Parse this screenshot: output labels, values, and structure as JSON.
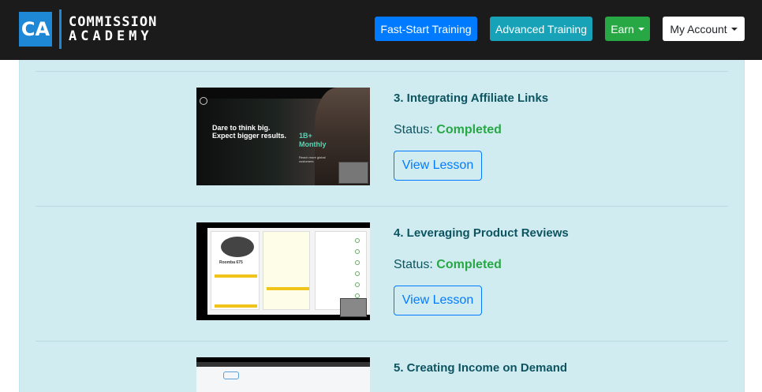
{
  "header": {
    "logo_badge": "CA",
    "logo_line1": "COMMISSION",
    "logo_line2": "ACADEMY",
    "nav": {
      "fast_start": "Fast-Start Training",
      "advanced": "Advanced Training",
      "earn": "Earn",
      "account": "My Account"
    }
  },
  "lessons": [
    {
      "title": "3. Integrating Affiliate Links",
      "status_label": "Status:",
      "status_value": "Completed",
      "button": "View Lesson",
      "thumb_headline": "Dare to think big. Expect bigger results.",
      "thumb_big": "1B+ Monthly",
      "thumb_reach": "Reach more global customers"
    },
    {
      "title": "4. Leveraging Product Reviews",
      "status_label": "Status:",
      "status_value": "Completed",
      "button": "View Lesson",
      "thumb_label": "Roomba 675"
    },
    {
      "title": "5. Creating Income on Demand"
    }
  ],
  "colors": {
    "header_bg": "#1b1b1b",
    "panel_bg": "#d1ecf1",
    "title_text": "#0c5460",
    "completed": "#28a745",
    "primary": "#007bff"
  }
}
